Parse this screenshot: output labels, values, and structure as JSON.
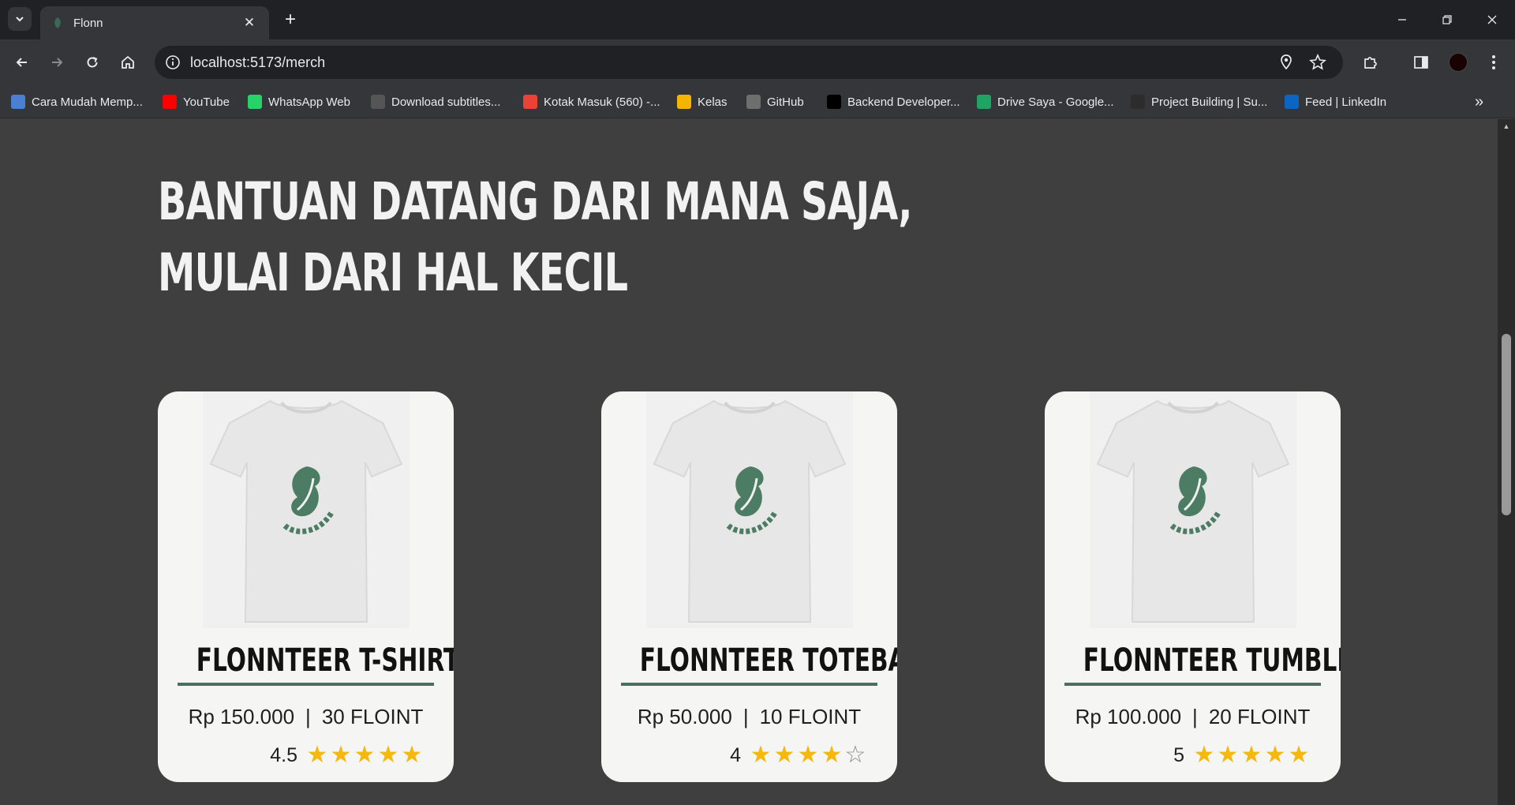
{
  "browser": {
    "tab_title": "Flonn",
    "url": "localhost:5173/merch",
    "bookmarks": [
      {
        "label": "Cara Mudah Memp...",
        "icon": "link-icon",
        "color": "#4a7fd4"
      },
      {
        "label": "YouTube",
        "icon": "youtube-icon",
        "color": "#ff0000"
      },
      {
        "label": "WhatsApp Web",
        "icon": "whatsapp-icon",
        "color": "#25d366"
      },
      {
        "label": "Download subtitles...",
        "icon": "file-icon",
        "color": "#555555"
      },
      {
        "label": "Kotak Masuk (560) -...",
        "icon": "gmail-icon",
        "color": "#ea4335"
      },
      {
        "label": "Kelas",
        "icon": "classroom-icon",
        "color": "#f4b400"
      },
      {
        "label": "GitHub",
        "icon": "github-icon",
        "color": "#6e6e6e"
      },
      {
        "label": "Backend Developer...",
        "icon": "roadmap-icon",
        "color": "#000000"
      },
      {
        "label": "Drive Saya - Google...",
        "icon": "drive-icon",
        "color": "#1fa463"
      },
      {
        "label": "Project Building | Su...",
        "icon": "project-icon",
        "color": "#2c2c2c"
      },
      {
        "label": "Feed | LinkedIn",
        "icon": "linkedin-icon",
        "color": "#0a66c2"
      }
    ]
  },
  "page": {
    "headline_line1": "BANTUAN DATANG DARI MANA SAJA,",
    "headline_line2": "MULAI DARI HAL KECIL"
  },
  "products": [
    {
      "name": "FLONNTEER T-SHIRT",
      "price": "Rp 150.000",
      "sep": "|",
      "points": "30 FLOINT",
      "rating_text": "4.5",
      "rating": 4.5,
      "stars": 5
    },
    {
      "name": "FLONNTEER TOTEBAG",
      "price": "Rp 50.000",
      "sep": "|",
      "points": "10 FLOINT",
      "rating_text": "4",
      "rating": 4,
      "stars": 5
    },
    {
      "name": "FLONNTEER TUMBLER",
      "price": "Rp 100.000",
      "sep": "|",
      "points": "20 FLOINT",
      "rating_text": "5",
      "rating": 5,
      "stars": 5
    }
  ],
  "colors": {
    "page_bg": "#3f3f3f",
    "card_bg": "#f5f6f3",
    "accent_green": "#4c6e5f",
    "star": "#f6b70f"
  }
}
